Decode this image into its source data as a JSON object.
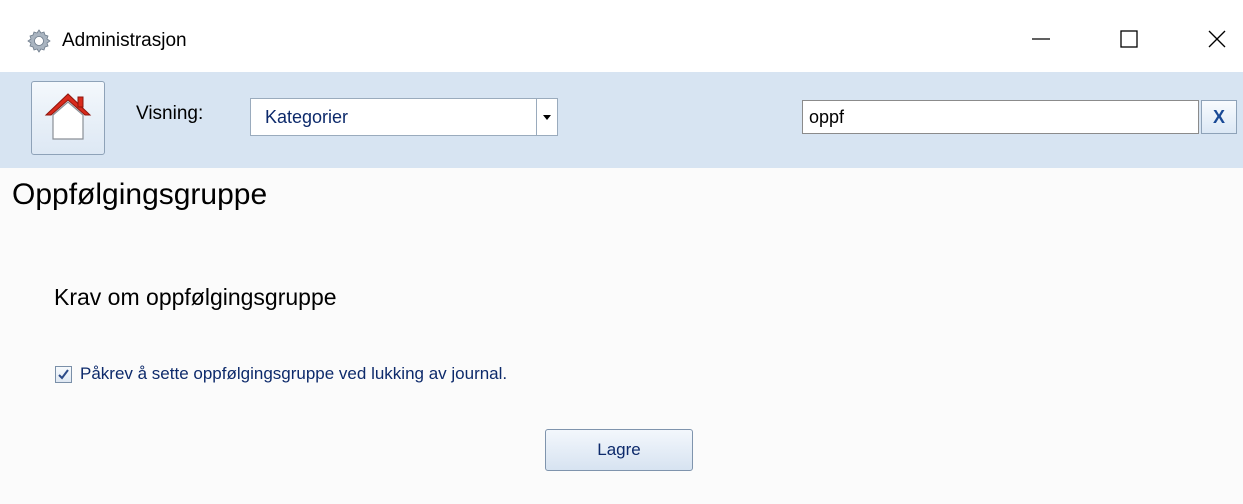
{
  "window": {
    "title": "Administrasjon",
    "app_icon": "gear-icon",
    "controls": [
      "minimize-icon",
      "maximize-icon",
      "close-icon"
    ]
  },
  "toolbar": {
    "home_icon": "house-icon",
    "view_label": "Visning:",
    "view_select_value": "Kategorier",
    "search_value": "oppf",
    "clear_label": "X"
  },
  "main": {
    "page_title": "Oppfølgingsgruppe",
    "section_title": "Krav om oppfølgingsgruppe",
    "checkbox_label": "Påkrev å sette oppfølgingsgruppe ved lukking av journal.",
    "checkbox_checked": true,
    "save_label": "Lagre"
  },
  "colors": {
    "toolbar_bg": "#d7e4f2",
    "label_blue": "#0d2a6b",
    "clear_x": "#1a4a96",
    "roof_red": "#d92a1c"
  }
}
